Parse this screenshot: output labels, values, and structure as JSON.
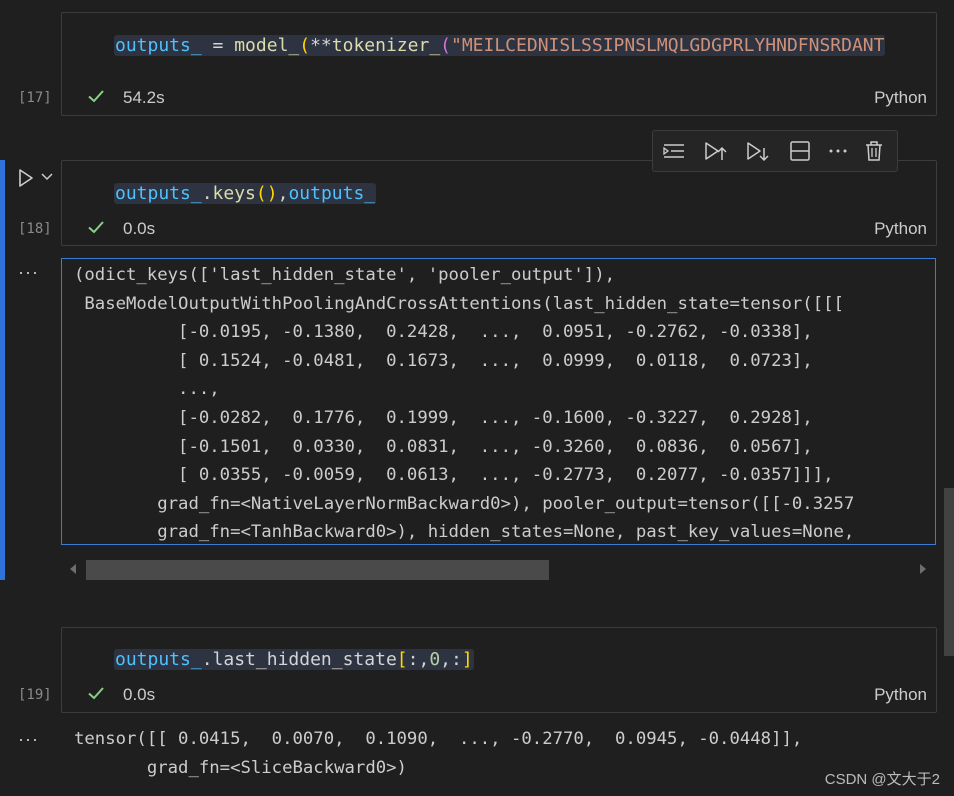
{
  "cells": [
    {
      "exec_count": "[17]",
      "code_tokens": [
        {
          "t": "outputs_",
          "c": "tk-var"
        },
        {
          "t": " = ",
          "c": "tk-plain"
        },
        {
          "t": "model_",
          "c": "tk-fn"
        },
        {
          "t": "(",
          "c": "tk-paren1"
        },
        {
          "t": "**",
          "c": "tk-plain"
        },
        {
          "t": "tokenizer_",
          "c": "tk-fn"
        },
        {
          "t": "(",
          "c": "tk-paren2"
        },
        {
          "t": "\"MEILCEDNISLSSIPNSLMQLGDGPRLYHNDFNSRDANT",
          "c": "tk-str"
        }
      ],
      "time": "54.2s",
      "language": "Python"
    },
    {
      "exec_count": "[18]",
      "code_tokens": [
        {
          "t": "outputs_",
          "c": "tk-var"
        },
        {
          "t": ".",
          "c": "tk-plain"
        },
        {
          "t": "keys",
          "c": "tk-fn"
        },
        {
          "t": "()",
          "c": "tk-paren1"
        },
        {
          "t": ",",
          "c": "tk-plain"
        },
        {
          "t": "outputs_",
          "c": "tk-var"
        }
      ],
      "time": "0.0s",
      "language": "Python",
      "output_lines": [
        "(odict_keys(['last_hidden_state', 'pooler_output']),",
        " BaseModelOutputWithPoolingAndCrossAttentions(last_hidden_state=tensor([[[",
        "          [-0.0195, -0.1380,  0.2428,  ...,  0.0951, -0.2762, -0.0338],",
        "          [ 0.1524, -0.0481,  0.1673,  ...,  0.0999,  0.0118,  0.0723],",
        "          ...,",
        "          [-0.0282,  0.1776,  0.1999,  ..., -0.1600, -0.3227,  0.2928],",
        "          [-0.1501,  0.0330,  0.0831,  ..., -0.3260,  0.0836,  0.0567],",
        "          [ 0.0355, -0.0059,  0.0613,  ..., -0.2773,  0.2077, -0.0357]]],",
        "        grad_fn=<NativeLayerNormBackward0>), pooler_output=tensor([[-0.3257",
        "        grad_fn=<TanhBackward0>), hidden_states=None, past_key_values=None,"
      ]
    },
    {
      "exec_count": "[19]",
      "code_tokens": [
        {
          "t": "outputs_",
          "c": "tk-var"
        },
        {
          "t": ".",
          "c": "tk-plain"
        },
        {
          "t": "last_hidden_state",
          "c": "tk-plain"
        },
        {
          "t": "[",
          "c": "tk-paren1"
        },
        {
          "t": ":,",
          "c": "tk-plain"
        },
        {
          "t": "0",
          "c": "tk-num"
        },
        {
          "t": ",:",
          "c": "tk-plain"
        },
        {
          "t": "]",
          "c": "tk-paren1"
        }
      ],
      "time": "0.0s",
      "language": "Python",
      "output_lines": [
        "tensor([[ 0.0415,  0.0070,  0.1090,  ..., -0.2770,  0.0945, -0.0448]],",
        "       grad_fn=<SliceBackward0>)"
      ]
    }
  ],
  "gutter_ellipsis": "···",
  "watermark": "CSDN @文大于2",
  "icons": {
    "run": "run-icon",
    "collapse": "chevron-down-icon",
    "check": "check-icon",
    "toolbar": [
      "run-above-icon",
      "run-below-icon",
      "execute-below-icon",
      "split-cell-icon",
      "more-icon",
      "delete-icon"
    ]
  },
  "colors": {
    "accent_blue": "#2f72d8",
    "success_green": "#89d185",
    "output_border": "#3c7bd6"
  }
}
